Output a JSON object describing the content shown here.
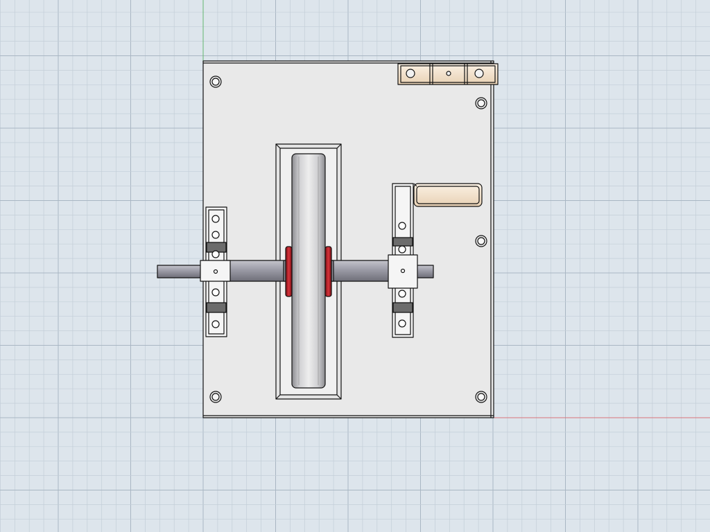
{
  "viewport": {
    "background": "#dde5ec",
    "grid_minor_color": "#c3ced8",
    "grid_major_color": "#a9b6c3",
    "axis_x_color": "#d9737a",
    "axis_y_color": "#62b56e"
  },
  "model": {
    "outline_color": "#111111",
    "plate_color": "#e9e9e9",
    "bracket_color": "#f5f5f5",
    "tan_part_color": "#f3e3cf",
    "shaft_color": "#9b9ba6",
    "wheel_color": "#d4d4d6",
    "rim_color": "#b91c24",
    "bearing_block_color": "#6c6c6c"
  }
}
